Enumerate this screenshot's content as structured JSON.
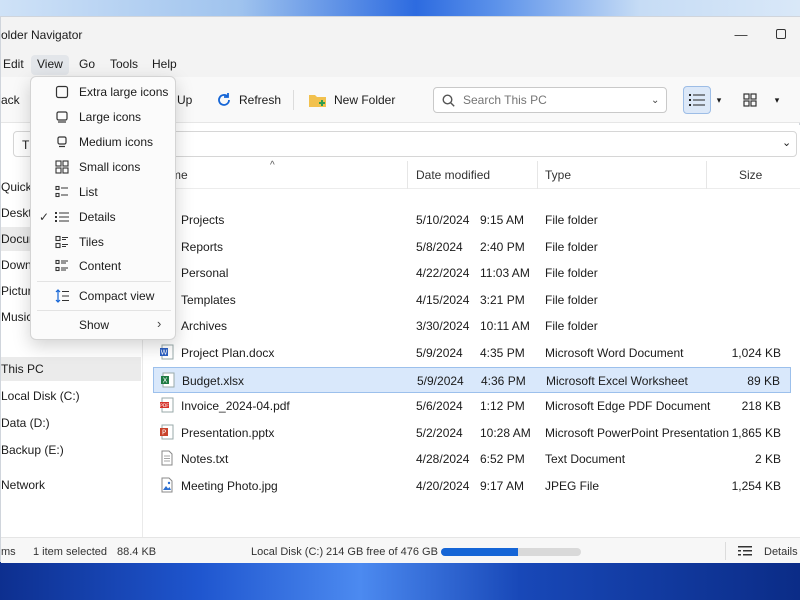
{
  "window": {
    "title": "older Navigator"
  },
  "menu": {
    "items": [
      "Edit",
      "View",
      "Go",
      "Tools",
      "Help"
    ]
  },
  "toolbar": {
    "back_label": "ack",
    "up_label": "Up",
    "refresh_label": "Refresh",
    "new_folder_label": "New Folder",
    "search_placeholder": "Search This PC"
  },
  "address": {
    "text": "Th"
  },
  "sidebar": {
    "items": [
      "Quick A",
      "Deskto",
      "Docum",
      "Downl",
      "Pictur",
      "Music",
      "This PC",
      "Local Disk (C:)",
      "Data (D:)",
      "Backup (E:)",
      "Network"
    ]
  },
  "view_menu": {
    "items": [
      "Extra large icons",
      "Large icons",
      "Medium icons",
      "Small icons",
      "List",
      "Details",
      "Tiles",
      "Content",
      "Compact view",
      "Show"
    ],
    "checked": "Details"
  },
  "columns": {
    "name": "me",
    "date": "Date modified",
    "type": "Type",
    "size": "Size"
  },
  "files": [
    {
      "name": "Projects",
      "date": "5/10/2024",
      "time": "9:15 AM",
      "type": "File folder",
      "size": "",
      "icon": "folder-icon"
    },
    {
      "name": "Reports",
      "date": "5/8/2024",
      "time": "2:40 PM",
      "type": "File folder",
      "size": "",
      "icon": "folder-icon"
    },
    {
      "name": "Personal",
      "date": "4/22/2024",
      "time": "11:03 AM",
      "type": "File folder",
      "size": "",
      "icon": "folder-icon"
    },
    {
      "name": "Templates",
      "date": "4/15/2024",
      "time": "3:21 PM",
      "type": "File folder",
      "size": "",
      "icon": "folder-icon"
    },
    {
      "name": "Archives",
      "date": "3/30/2024",
      "time": "10:11 AM",
      "type": "File folder",
      "size": "",
      "icon": "folder-icon"
    },
    {
      "name": "Project Plan.docx",
      "date": "5/9/2024",
      "time": "4:35 PM",
      "type": "Microsoft Word Document",
      "size": "1,024 KB",
      "icon": "word-icon"
    },
    {
      "name": "Budget.xlsx",
      "date": "5/9/2024",
      "time": "4:36 PM",
      "type": "Microsoft Excel Worksheet",
      "size": "89 KB",
      "icon": "excel-icon"
    },
    {
      "name": "Invoice_2024-04.pdf",
      "date": "5/6/2024",
      "time": "1:12 PM",
      "type": "Microsoft Edge PDF Document",
      "size": "218 KB",
      "icon": "pdf-icon"
    },
    {
      "name": "Presentation.pptx",
      "date": "5/2/2024",
      "time": "10:28 AM",
      "type": "Microsoft PowerPoint Presentation",
      "size": "1,865 KB",
      "icon": "powerpoint-icon"
    },
    {
      "name": "Notes.txt",
      "date": "4/28/2024",
      "time": "6:52 PM",
      "type": "Text Document",
      "size": "2 KB",
      "icon": "text-file-icon"
    },
    {
      "name": "Meeting Photo.jpg",
      "date": "4/20/2024",
      "time": "9:17 AM",
      "type": "JPEG File",
      "size": "1,254 KB",
      "icon": "image-file-icon"
    }
  ],
  "selected_file": "Budget.xlsx",
  "status": {
    "items": "ms",
    "selected": "1 item selected",
    "selected_size": "88.4 KB",
    "disk_label": "Local Disk (C:)",
    "disk_free": "214 GB free of 476 GB",
    "disk_used_fraction": 0.55,
    "details_label": "Details"
  },
  "colors": {
    "accent": "#1565d6",
    "selection": "#d9e8fb",
    "folder": "#f2c14e"
  }
}
